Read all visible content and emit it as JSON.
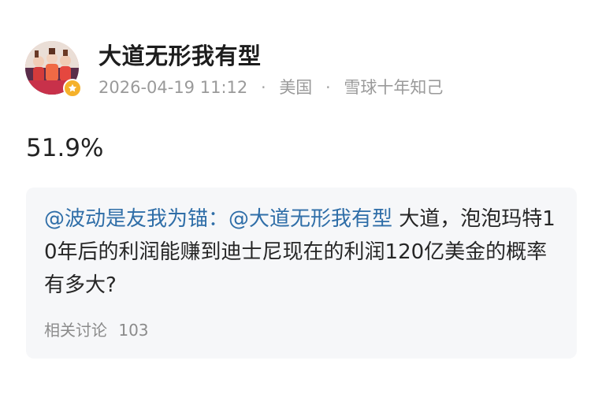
{
  "post": {
    "author": {
      "name": "大道无形我有型",
      "avatar_icon": "user-avatar",
      "badge_icon": "star-badge-icon"
    },
    "meta": {
      "date": "2026-04-19 11:12",
      "region": "美国",
      "level": "雪球十年知己"
    },
    "body": "51.9%",
    "quote": {
      "mention_1": "@波动是友我为锚",
      "separator": "：",
      "mention_2": "@大道无形我有型",
      "text": " 大道，泡泡玛特10年后的利润能赚到迪士尼现在的利润120亿美金的概率有多大?",
      "discussion_label": "相关讨论",
      "discussion_count": "103"
    }
  },
  "colors": {
    "text": "#1f1f1f",
    "muted": "#9a9a9a",
    "mention": "#2f6ea8",
    "card_bg": "#f6f7f9",
    "badge": "#f5b12a"
  }
}
